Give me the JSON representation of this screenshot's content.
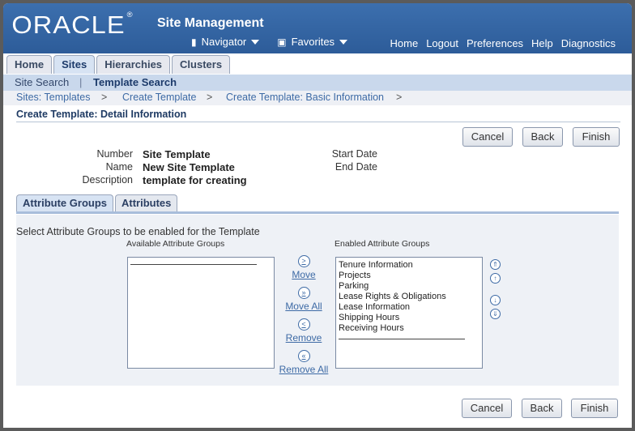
{
  "header": {
    "logo": "ORACLE",
    "logo_mark": "®",
    "app_title": "Site Management",
    "navigator": "Navigator",
    "favorites": "Favorites",
    "links": [
      "Home",
      "Logout",
      "Preferences",
      "Help",
      "Diagnostics"
    ]
  },
  "tabs": [
    "Home",
    "Sites",
    "Hierarchies",
    "Clusters"
  ],
  "subtabs": {
    "site_search": "Site Search",
    "separator": "|",
    "template_search": "Template Search"
  },
  "breadcrumbs": [
    "Sites: Templates",
    ">",
    "Create Template",
    ">",
    "Create Template: Basic Information",
    ">"
  ],
  "page_title": "Create Template: Detail Information",
  "buttons": {
    "cancel": "Cancel",
    "back": "Back",
    "finish": "Finish"
  },
  "details": {
    "number_label": "Number",
    "number_value": "Site Template",
    "name_label": "Name",
    "name_value": "New Site Template",
    "description_label": "Description",
    "description_value": "template for creating",
    "start_date_label": "Start Date",
    "end_date_label": "End Date"
  },
  "attr_tabs": [
    "Attribute Groups",
    "Attributes"
  ],
  "panel": {
    "instruction": "Select Attribute Groups to be enabled for the Template",
    "available_header": "Available Attribute Groups",
    "enabled_header": "Enabled Attribute Groups",
    "enabled_items": [
      "Tenure Information",
      "Projects",
      "Parking",
      "Lease Rights & Obligations",
      "Lease Information",
      "Shipping Hours",
      "Receiving Hours"
    ],
    "move": "Move",
    "move_all": "Move All",
    "remove": "Remove",
    "remove_all": "Remove All"
  }
}
